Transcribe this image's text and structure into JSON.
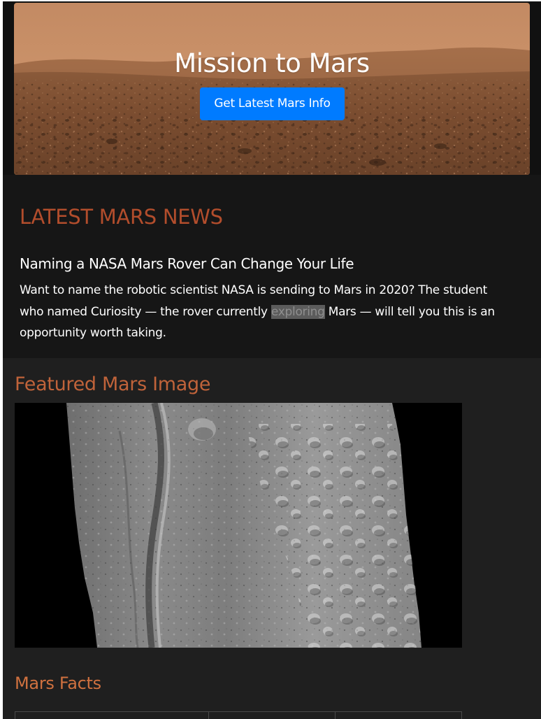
{
  "hero": {
    "title": "Mission to Mars",
    "button_label": "Get Latest Mars Info"
  },
  "news": {
    "heading": "LATEST MARS NEWS",
    "title": "Naming a NASA Mars Rover Can Change Your Life",
    "body_before": "Want to name the robotic scientist NASA is sending to Mars in 2020? The student who named Curiosity — the rover currently ",
    "body_highlight": "exploring",
    "body_after": " Mars — will tell you this is an opportunity worth taking."
  },
  "featured": {
    "heading": "Featured Mars Image"
  },
  "facts": {
    "heading": "Mars Facts"
  },
  "colors": {
    "news_heading": "#b24d2c",
    "featured_heading": "#c0633a",
    "facts_heading": "#d0713f",
    "button": "#007bff",
    "page_background": "#111111"
  },
  "icons": []
}
